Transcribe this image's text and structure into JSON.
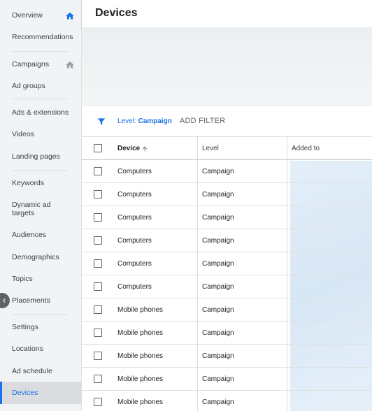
{
  "sidebar": {
    "items": [
      {
        "label": "Overview",
        "icon": "home-icon"
      },
      {
        "label": "Recommendations"
      },
      {
        "label": "Campaigns",
        "icon": "home-icon"
      },
      {
        "label": "Ad groups"
      },
      {
        "label": "Ads & extensions"
      },
      {
        "label": "Videos"
      },
      {
        "label": "Landing pages"
      },
      {
        "label": "Keywords"
      },
      {
        "label": "Dynamic ad targets"
      },
      {
        "label": "Audiences"
      },
      {
        "label": "Demographics"
      },
      {
        "label": "Topics"
      },
      {
        "label": "Placements"
      },
      {
        "label": "Settings"
      },
      {
        "label": "Locations"
      },
      {
        "label": "Ad schedule"
      },
      {
        "label": "Devices",
        "active": true
      }
    ]
  },
  "header": {
    "title": "Devices"
  },
  "filter": {
    "level_prefix": "Level: ",
    "level_value": "Campaign",
    "add_filter": "ADD FILTER"
  },
  "table": {
    "columns": [
      "Device",
      "Level",
      "Added to"
    ],
    "rows": [
      {
        "device": "Computers",
        "level": "Campaign"
      },
      {
        "device": "Computers",
        "level": "Campaign"
      },
      {
        "device": "Computers",
        "level": "Campaign"
      },
      {
        "device": "Computers",
        "level": "Campaign"
      },
      {
        "device": "Computers",
        "level": "Campaign"
      },
      {
        "device": "Computers",
        "level": "Campaign"
      },
      {
        "device": "Mobile phones",
        "level": "Campaign"
      },
      {
        "device": "Mobile phones",
        "level": "Campaign"
      },
      {
        "device": "Mobile phones",
        "level": "Campaign"
      },
      {
        "device": "Mobile phones",
        "level": "Campaign"
      },
      {
        "device": "Mobile phones",
        "level": "Campaign"
      }
    ]
  },
  "colors": {
    "accent": "#1a73e8",
    "sidebar_bg": "#f1f3f4",
    "active_bg": "#dadce0"
  }
}
